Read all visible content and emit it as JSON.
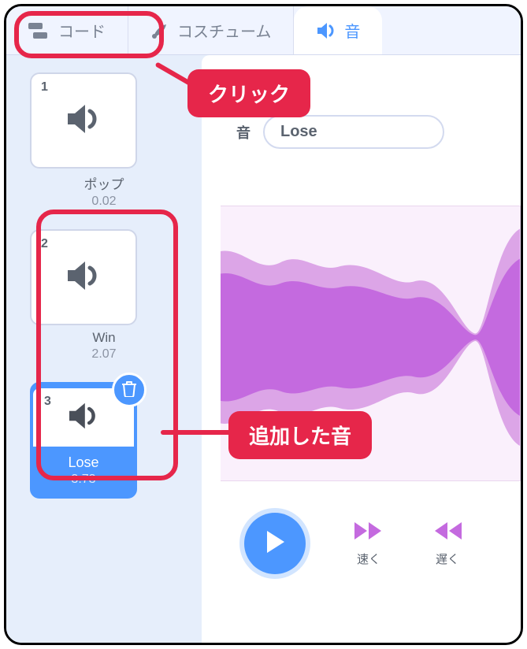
{
  "tabs": {
    "code": {
      "label": "コード"
    },
    "costumes": {
      "label": "コスチューム"
    },
    "sounds": {
      "label": "音"
    }
  },
  "sidebar": {
    "items": [
      {
        "index": "1",
        "name": "ポップ",
        "duration": "0.02"
      },
      {
        "index": "2",
        "name": "Win",
        "duration": "2.07"
      },
      {
        "index": "3",
        "name": "Lose",
        "duration": "3.73"
      }
    ]
  },
  "editor": {
    "field_label": "音",
    "name_value": "Lose"
  },
  "controls": {
    "faster": "速く",
    "slower": "遅く"
  },
  "callouts": {
    "click": "クリック",
    "added": "追加した音"
  },
  "colors": {
    "accent": "#4c97ff",
    "callout": "#e6264a",
    "wave": "#ca7ed8"
  }
}
